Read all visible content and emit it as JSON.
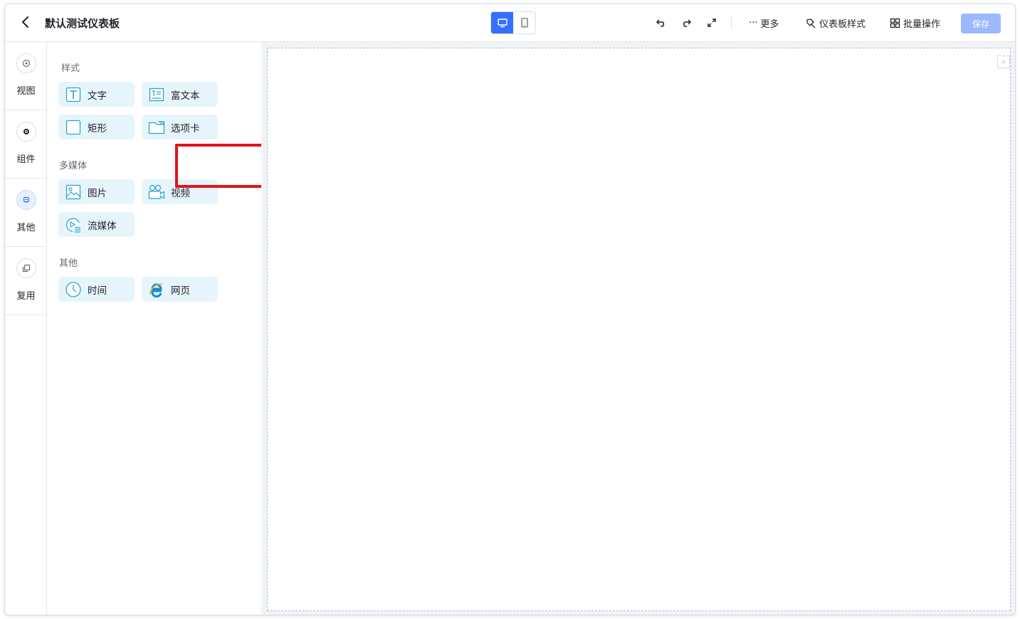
{
  "header": {
    "title": "默认测试仪表板",
    "more_label": "更多",
    "dashboard_style_label": "仪表板样式",
    "batch_label": "批量操作",
    "save_label": "保存"
  },
  "rail": {
    "items": [
      {
        "label": "视图",
        "icon": "view-icon"
      },
      {
        "label": "组件",
        "icon": "component-icon"
      },
      {
        "label": "其他",
        "icon": "other-icon",
        "active": true
      },
      {
        "label": "复用",
        "icon": "reuse-icon"
      }
    ]
  },
  "panel": {
    "sections": [
      {
        "title": "样式",
        "items": [
          "文字",
          "富文本",
          "矩形",
          "选项卡"
        ]
      },
      {
        "title": "多媒体",
        "items": [
          "图片",
          "视频",
          "流媒体"
        ]
      },
      {
        "title": "其他",
        "items": [
          "时间",
          "网页"
        ]
      }
    ],
    "highlighted_item": "选项卡"
  },
  "colors": {
    "accent": "#3370ff",
    "chip_bg": "#e6f5fc",
    "highlight": "#e3121b",
    "save_disabled": "#9cb9ff",
    "icon_blue": "#2aa3cf"
  }
}
